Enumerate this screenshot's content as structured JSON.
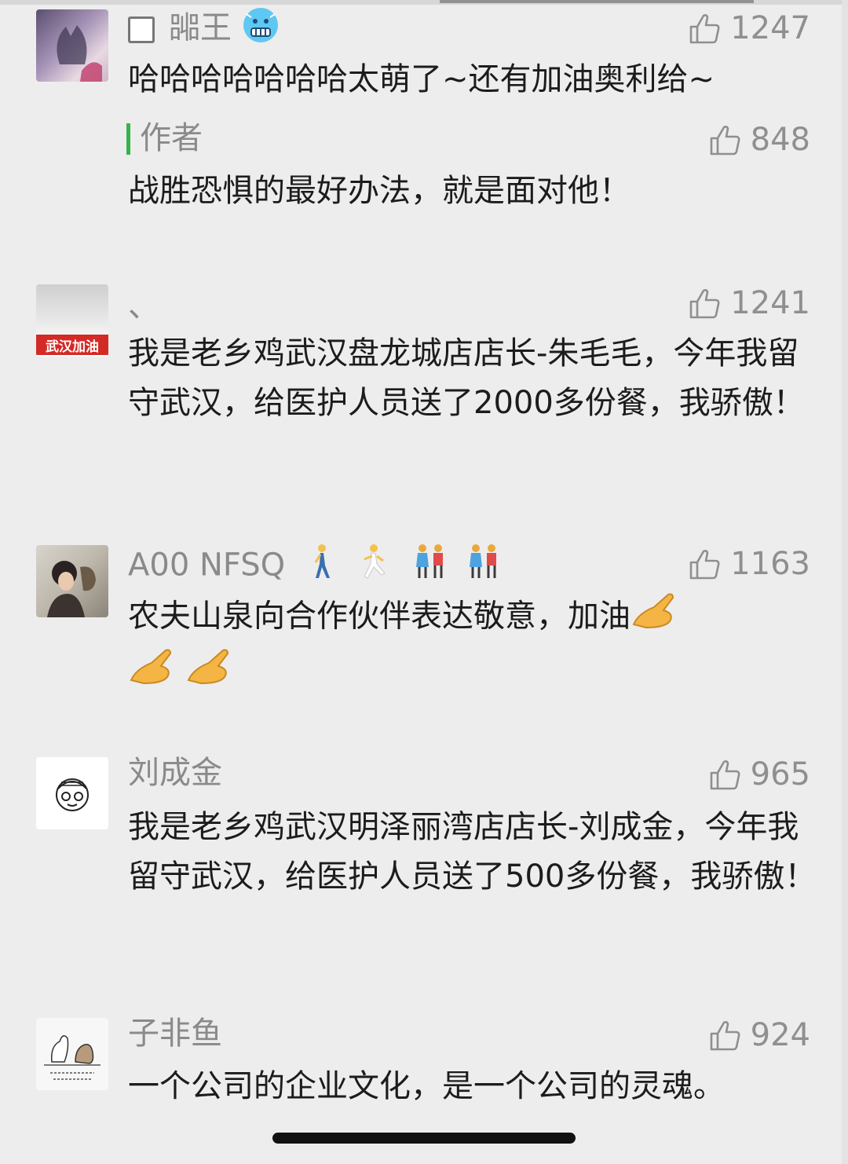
{
  "comments": [
    {
      "name": "嘂王",
      "likes": "1247",
      "text": "哈哈哈哈哈哈哈太萌了~还有加油奥利给~",
      "reply": {
        "label": "作者",
        "likes": "848",
        "text": "战胜恐惧的最好办法，就是面对他！"
      }
    },
    {
      "name": "、",
      "likes": "1241",
      "avatar_text": "武汉加油",
      "text": "我是老乡鸡武汉盘龙城店店长-朱毛毛，今年我留守武汉，给医护人员送了2000多份餐，我骄傲！"
    },
    {
      "name": "A00 NFSQ",
      "likes": "1163",
      "text": "农夫山泉向合作伙伴表达敬意，加油"
    },
    {
      "name": "刘成金",
      "likes": "965",
      "text": "我是老乡鸡武汉明泽丽湾店店长-刘成金，今年我留守武汉，给医护人员送了500多份餐，我骄傲！"
    },
    {
      "name": "子非鱼",
      "likes": "924",
      "text": "一个公司的企业文化，是一个公司的灵魂。"
    }
  ],
  "icons": {
    "like": "thumbs-up-icon",
    "freezing_face": "cold-face-emoji",
    "walking": "person-walking-emoji",
    "running": "person-running-emoji",
    "couple": "couple-holding-hands-emoji",
    "bow": "bowing-hand-emoji"
  },
  "colors": {
    "background": "#ededed",
    "author_bar": "#35b34a",
    "meta_gray": "#8a8a8a"
  }
}
